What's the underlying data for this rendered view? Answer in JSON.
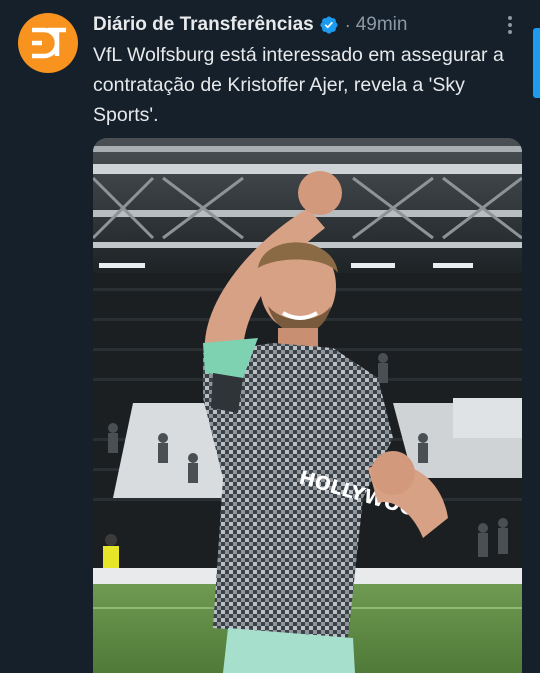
{
  "tweet": {
    "author_name": "Diário de Transferências",
    "separator": "·",
    "timestamp": "49min",
    "text": "VfL Wolfsburg está interessado em assegurar a contratação de Kristoffer Ajer, revela a 'Sky Sports'.",
    "avatar_icon": "dt-logo-icon",
    "verified_icon": "verified-badge-icon",
    "more_icon": "more-options-icon"
  },
  "media": {
    "description_icon": "football-player-photo",
    "shirt_text": "HOLLYWOOD"
  },
  "colors": {
    "background": "#15202b",
    "avatar": "#f7931e",
    "verified": "#1d9bf0",
    "secondary_text": "#8b98a5"
  }
}
